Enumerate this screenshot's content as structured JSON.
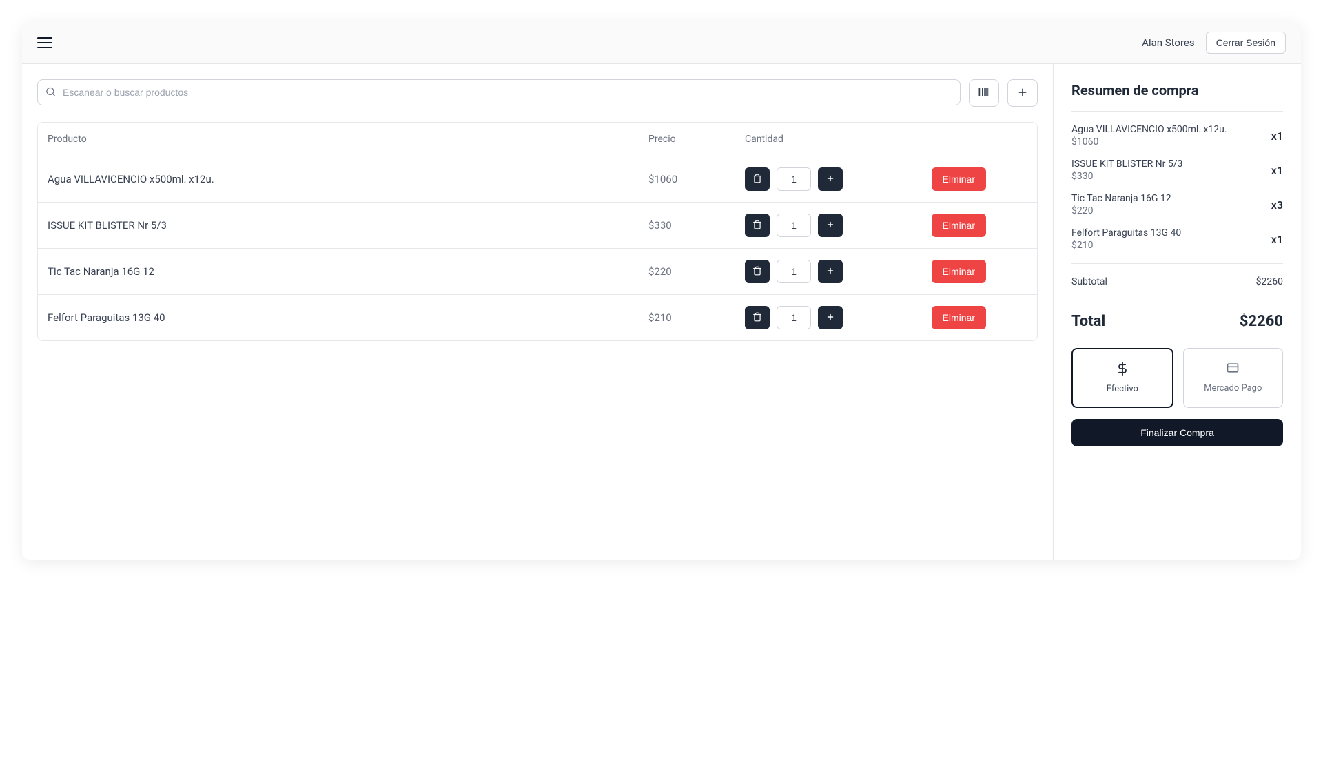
{
  "header": {
    "user_name": "Alan Stores",
    "logout_label": "Cerrar Sesión"
  },
  "search": {
    "placeholder": "Escanear o buscar productos",
    "value": ""
  },
  "table": {
    "headers": {
      "product": "Producto",
      "price": "Precio",
      "quantity": "Cantidad"
    },
    "remove_label": "Elminar",
    "rows": [
      {
        "name": "Agua VILLAVICENCIO x500ml. x12u.",
        "price": "$1060",
        "qty": "1"
      },
      {
        "name": "ISSUE KIT BLISTER Nr 5/3",
        "price": "$330",
        "qty": "1"
      },
      {
        "name": "Tic Tac Naranja 16G 12",
        "price": "$220",
        "qty": "1"
      },
      {
        "name": "Felfort Paraguitas 13G 40",
        "price": "$210",
        "qty": "1"
      }
    ]
  },
  "summary": {
    "title": "Resumen de compra",
    "items": [
      {
        "name": "Agua VILLAVICENCIO x500ml. x12u.",
        "price": "$1060",
        "qty": "x1"
      },
      {
        "name": "ISSUE KIT BLISTER Nr 5/3",
        "price": "$330",
        "qty": "x1"
      },
      {
        "name": "Tic Tac Naranja 16G 12",
        "price": "$220",
        "qty": "x3"
      },
      {
        "name": "Felfort Paraguitas 13G 40",
        "price": "$210",
        "qty": "x1"
      }
    ],
    "subtotal_label": "Subtotal",
    "subtotal_value": "$2260",
    "total_label": "Total",
    "total_value": "$2260",
    "payment": {
      "cash": "Efectivo",
      "mercado_pago": "Mercado Pago"
    },
    "finalize_label": "Finalizar Compra"
  }
}
